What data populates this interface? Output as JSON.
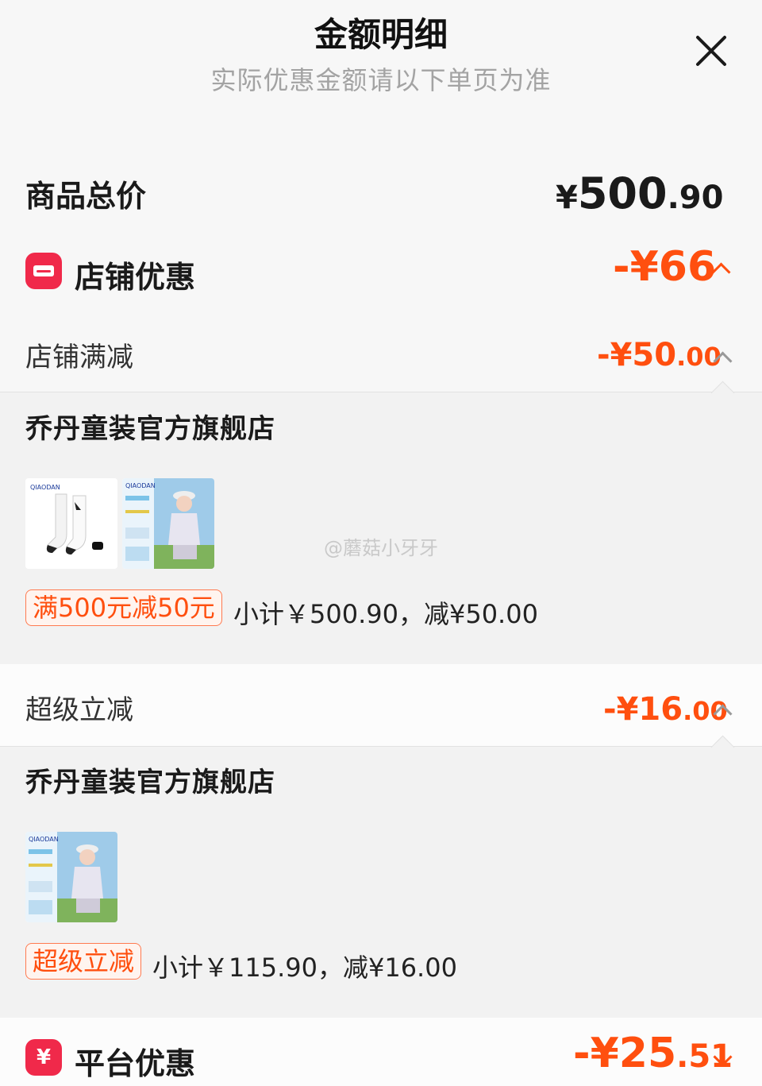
{
  "header": {
    "title": "金额明细",
    "subtitle": "实际优惠金额请以下单页为准"
  },
  "total": {
    "label": "商品总价",
    "symbol": "¥",
    "integer": "500",
    "decimal": ".90"
  },
  "shop_discount": {
    "label": "店铺优惠",
    "amount": "-¥66",
    "icon": "shop-icon"
  },
  "sections": [
    {
      "label": "店铺满减",
      "amount_int": "-¥50",
      "amount_dec": ".00",
      "store": "乔丹童装官方旗舰店",
      "tag": "满500元减50元",
      "subtotal": "小计￥500.90，减¥50.00"
    },
    {
      "label": "超级立减",
      "amount_int": "-¥16",
      "amount_dec": ".00",
      "store": "乔丹童装官方旗舰店",
      "tag": "超级立减",
      "subtotal": "小计￥115.90，减¥16.00"
    }
  ],
  "platform_discount": {
    "label": "平台优惠",
    "amount_int": "-¥25",
    "amount_dec": ".51",
    "icon": "yen-icon"
  },
  "watermark": "@蘑菇小牙牙",
  "colors": {
    "accent": "#ff4f0f",
    "badge": "#f0294a"
  }
}
